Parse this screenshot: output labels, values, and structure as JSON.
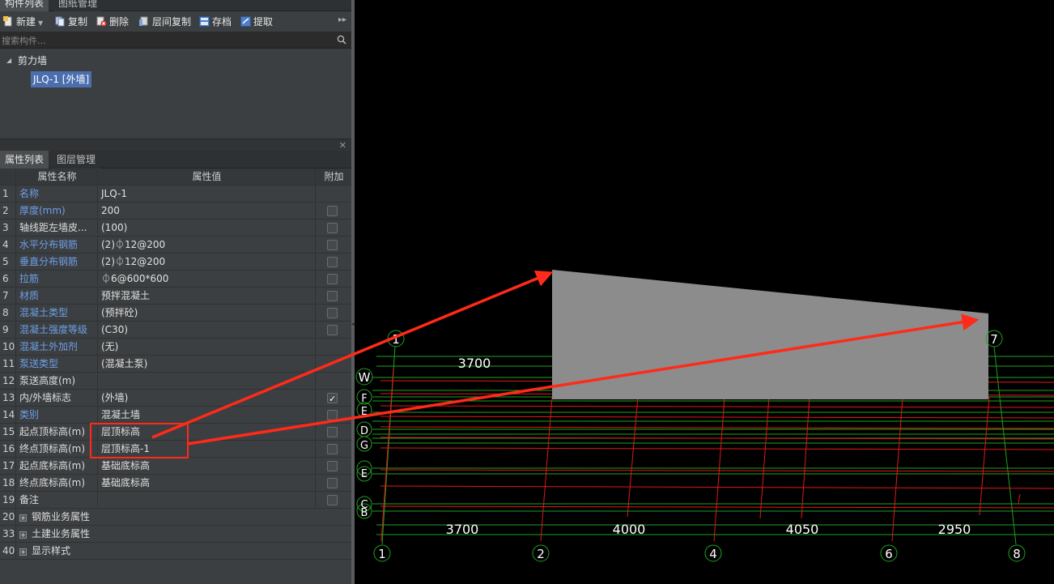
{
  "top_tabs": [
    "构件列表",
    "图纸管理"
  ],
  "toolbar": {
    "new_label": "新建",
    "copy_label": "复制",
    "delete_label": "删除",
    "floor_copy_label": "层间复制",
    "archive_label": "存档",
    "extract_label": "提取"
  },
  "search": {
    "placeholder": "搜索构件..."
  },
  "tree": {
    "root": "剪力墙",
    "child": "JLQ-1 [外墙]"
  },
  "prop_tabs": [
    "属性列表",
    "图层管理"
  ],
  "grid": {
    "headers": {
      "name": "属性名称",
      "value": "属性值",
      "add": "附加"
    },
    "rows": [
      {
        "num": "1",
        "name": "名称",
        "value": "JLQ-1",
        "blue": true,
        "checkbox": false,
        "checked": false
      },
      {
        "num": "2",
        "name": "厚度(mm)",
        "value": "200",
        "blue": true,
        "checkbox": true,
        "checked": false
      },
      {
        "num": "3",
        "name": "轴线距左墙皮...",
        "value": "(100)",
        "blue": false,
        "checkbox": true,
        "checked": false
      },
      {
        "num": "4",
        "name": "水平分布钢筋",
        "value": "(2)⏀12@200",
        "blue": true,
        "checkbox": true,
        "checked": false
      },
      {
        "num": "5",
        "name": "垂直分布钢筋",
        "value": "(2)⏀12@200",
        "blue": true,
        "checkbox": true,
        "checked": false
      },
      {
        "num": "6",
        "name": "拉筋",
        "value": "⏀6@600*600",
        "blue": true,
        "checkbox": true,
        "checked": false
      },
      {
        "num": "7",
        "name": "材质",
        "value": "预拌混凝土",
        "blue": true,
        "checkbox": true,
        "checked": false
      },
      {
        "num": "8",
        "name": "混凝土类型",
        "value": "(预拌砼)",
        "blue": true,
        "checkbox": true,
        "checked": false
      },
      {
        "num": "9",
        "name": "混凝土强度等级",
        "value": "(C30)",
        "blue": true,
        "checkbox": true,
        "checked": false
      },
      {
        "num": "10",
        "name": "混凝土外加剂",
        "value": "(无)",
        "blue": true,
        "checkbox": false,
        "checked": false
      },
      {
        "num": "11",
        "name": "泵送类型",
        "value": "(混凝土泵)",
        "blue": true,
        "checkbox": false,
        "checked": false
      },
      {
        "num": "12",
        "name": "泵送高度(m)",
        "value": "",
        "blue": false,
        "checkbox": false,
        "checked": false
      },
      {
        "num": "13",
        "name": "内/外墙标志",
        "value": "(外墙)",
        "blue": false,
        "checkbox": true,
        "checked": true
      },
      {
        "num": "14",
        "name": "类别",
        "value": "混凝土墙",
        "blue": true,
        "checkbox": true,
        "checked": false
      },
      {
        "num": "15",
        "name": "起点顶标高(m)",
        "value": "层顶标高",
        "blue": false,
        "checkbox": true,
        "checked": false
      },
      {
        "num": "16",
        "name": "终点顶标高(m)",
        "value": "层顶标高-1",
        "blue": false,
        "checkbox": true,
        "checked": false
      },
      {
        "num": "17",
        "name": "起点底标高(m)",
        "value": "基础底标高",
        "blue": false,
        "checkbox": true,
        "checked": false
      },
      {
        "num": "18",
        "name": "终点底标高(m)",
        "value": "基础底标高",
        "blue": false,
        "checkbox": true,
        "checked": false
      },
      {
        "num": "19",
        "name": "备注",
        "value": "",
        "blue": false,
        "checkbox": true,
        "checked": false
      },
      {
        "num": "20",
        "name": "钢筋业务属性",
        "value": "",
        "blue": false,
        "checkbox": false,
        "checked": false,
        "group": true
      },
      {
        "num": "33",
        "name": "土建业务属性",
        "value": "",
        "blue": false,
        "checkbox": false,
        "checked": false,
        "group": true
      },
      {
        "num": "40",
        "name": "显示样式",
        "value": "",
        "blue": false,
        "checkbox": false,
        "checked": false,
        "group": true
      }
    ]
  },
  "cad": {
    "colors": {
      "axis_green": "#1ea21e",
      "red_line": "#e01818",
      "wall_grey": "#8c8c8c",
      "arrow_red": "#ff2a1a"
    },
    "top_axis_labels": [
      "1",
      "7"
    ],
    "bottom_axis_labels": [
      "1",
      "2",
      "4",
      "6",
      "8"
    ],
    "left_axis_labels": [
      "W",
      "C",
      "B"
    ],
    "left_axis_partial": [
      "F",
      "E",
      "D",
      "C",
      "G",
      "E"
    ],
    "top_dimension": "3700",
    "bottom_dimensions": [
      "3700",
      "4000",
      "4050",
      "2950"
    ]
  }
}
